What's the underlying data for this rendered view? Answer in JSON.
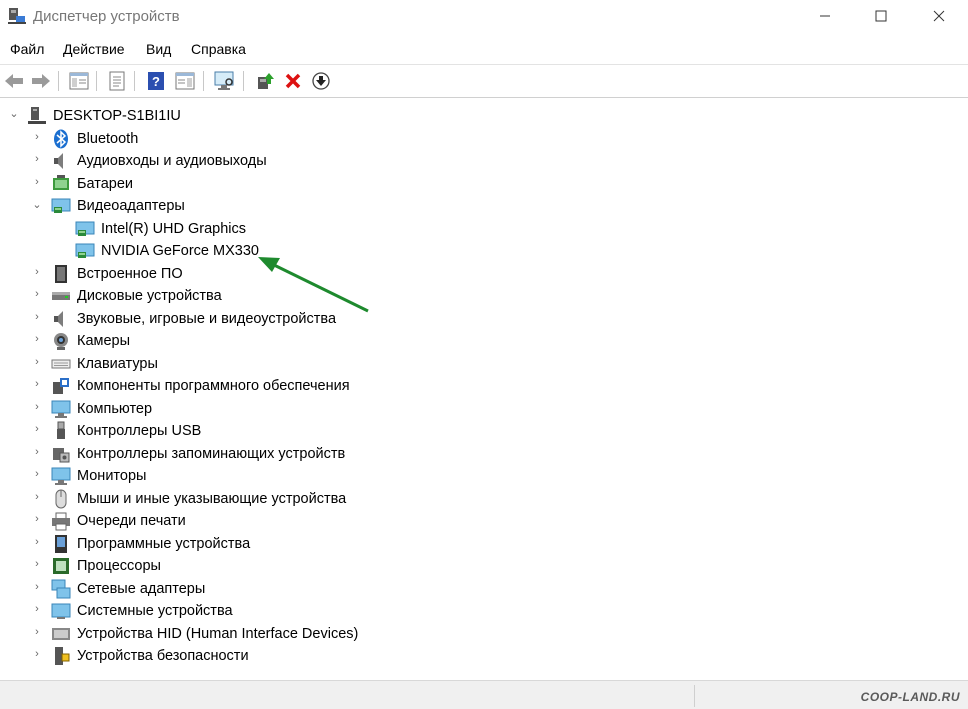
{
  "window": {
    "title": "Диспетчер устройств"
  },
  "menu": [
    "Файл",
    "Действие",
    "Вид",
    "Справка"
  ],
  "tree": {
    "root": "DESKTOP-S1BI1IU",
    "categories": [
      "Bluetooth",
      "Аудиовходы и аудиовыходы",
      "Батареи",
      "Видеоадаптеры",
      "Встроенное ПО",
      "Дисковые устройства",
      "Звуковые, игровые и видеоустройства",
      "Камеры",
      "Клавиатуры",
      "Компоненты программного обеспечения",
      "Компьютер",
      "Контроллеры USB",
      "Контроллеры запоминающих устройств",
      "Мониторы",
      "Мыши и иные указывающие устройства",
      "Очереди печати",
      "Программные устройства",
      "Процессоры",
      "Сетевые адаптеры",
      "Системные устройства",
      "Устройства HID (Human Interface Devices)",
      "Устройства безопасности"
    ],
    "video_adapters": [
      "Intel(R) UHD Graphics",
      "NVIDIA GeForce MX330"
    ]
  },
  "watermark": "COOP-LAND.RU",
  "colors": {
    "arrow": "#1e8a2e",
    "accent": "#0078d7"
  }
}
